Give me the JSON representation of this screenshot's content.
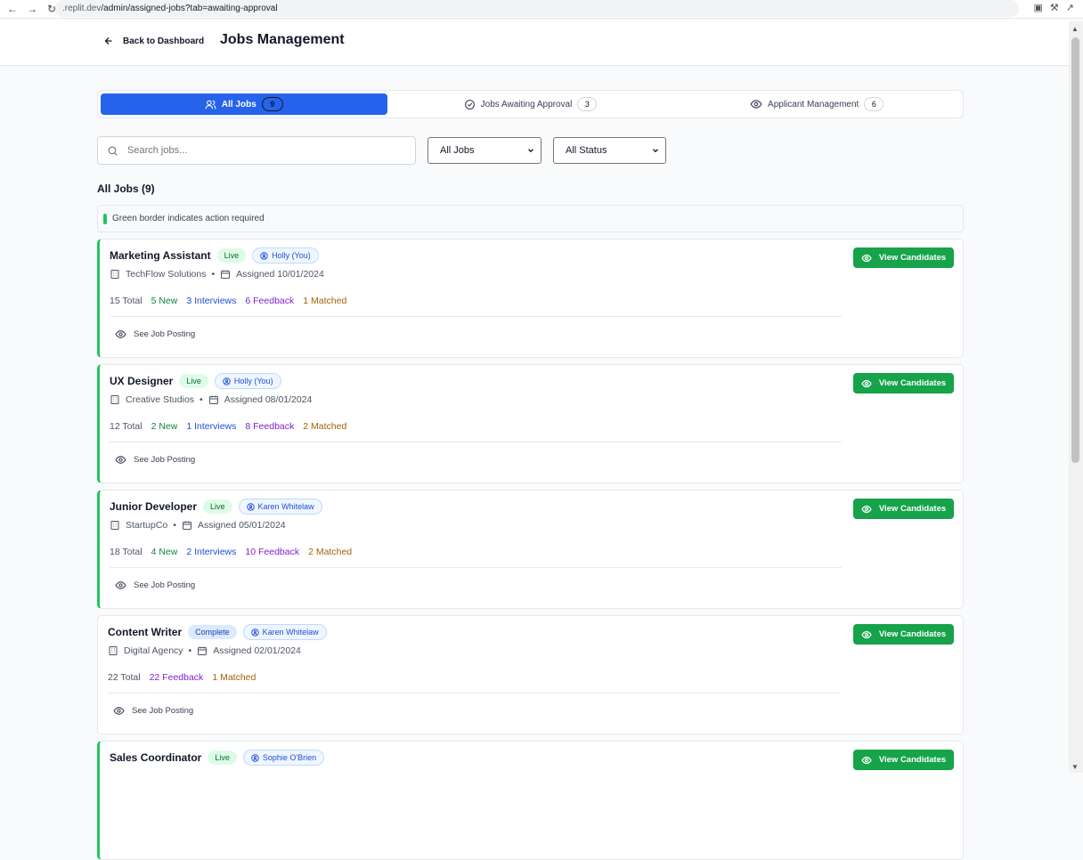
{
  "browser": {
    "url_prefix": ".replit.dev",
    "url_path": "/admin/assigned-jobs?tab=awaiting-approval"
  },
  "header": {
    "back_label": "Back to Dashboard",
    "title": "Jobs Management"
  },
  "tabs": [
    {
      "label": "All Jobs",
      "count": "9",
      "active": true
    },
    {
      "label": "Jobs Awaiting Approval",
      "count": "3",
      "active": false
    },
    {
      "label": "Applicant Management",
      "count": "6",
      "active": false
    }
  ],
  "filters": {
    "search_placeholder": "Search jobs...",
    "jobs_select": "All Jobs",
    "status_select": "All Status"
  },
  "list": {
    "heading": "All Jobs (9)",
    "hint": "Green border indicates action required",
    "view_label": "View Candidates",
    "posting_label": "See Job Posting"
  },
  "jobs": [
    {
      "title": "Marketing Assistant",
      "status": "Live",
      "owner": "Holly (You)",
      "company": "TechFlow Solutions",
      "assigned": "Assigned 10/01/2024",
      "total": "15 Total",
      "new": "5 New",
      "interviews": "3 Interviews",
      "feedback": "6 Feedback",
      "matched": "1 Matched"
    },
    {
      "title": "UX Designer",
      "status": "Live",
      "owner": "Holly (You)",
      "company": "Creative Studios",
      "assigned": "Assigned 08/01/2024",
      "total": "12 Total",
      "new": "2 New",
      "interviews": "1 Interviews",
      "feedback": "8 Feedback",
      "matched": "2 Matched"
    },
    {
      "title": "Junior Developer",
      "status": "Live",
      "owner": "Karen Whitelaw",
      "company": "StartupCo",
      "assigned": "Assigned 05/01/2024",
      "total": "18 Total",
      "new": "4 New",
      "interviews": "2 Interviews",
      "feedback": "10 Feedback",
      "matched": "2 Matched"
    },
    {
      "title": "Content Writer",
      "status": "Complete",
      "owner": "Karen Whitelaw",
      "company": "Digital Agency",
      "assigned": "Assigned 02/01/2024",
      "total": "22 Total",
      "feedback": "22 Feedback",
      "matched": "1 Matched"
    },
    {
      "title": "Sales Coordinator",
      "status": "Live",
      "owner": "Sophie O'Brien"
    }
  ]
}
